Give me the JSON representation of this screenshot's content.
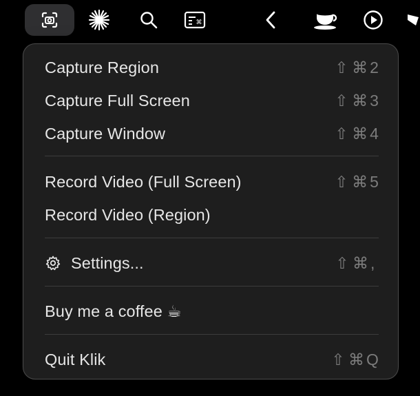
{
  "menubar": {
    "icons": [
      "camera-icon",
      "starburst-icon",
      "search-icon",
      "keyboard-display-icon",
      "chevron-left-icon",
      "coffee-cup-icon",
      "play-circle-icon",
      "partial-icon"
    ]
  },
  "menu": {
    "capture_region": {
      "label": "Capture Region",
      "shortcut": "2"
    },
    "capture_full_screen": {
      "label": "Capture Full Screen",
      "shortcut": "3"
    },
    "capture_window": {
      "label": "Capture Window",
      "shortcut": "4"
    },
    "record_full_screen": {
      "label": "Record Video (Full Screen)",
      "shortcut": "5"
    },
    "record_region": {
      "label": "Record Video (Region)"
    },
    "settings": {
      "label": "Settings...",
      "shortcut": ","
    },
    "buy_coffee": {
      "label": "Buy me a coffee ☕"
    },
    "quit": {
      "label": "Quit Klik",
      "shortcut": "Q"
    },
    "modifiers": {
      "shift": "⇧",
      "command": "⌘"
    }
  },
  "colors": {
    "menu_bg": "#1e1e1e",
    "text": "#e6e6e6",
    "shortcut_text": "#7c7c7c",
    "separator": "#3d3d3d"
  }
}
